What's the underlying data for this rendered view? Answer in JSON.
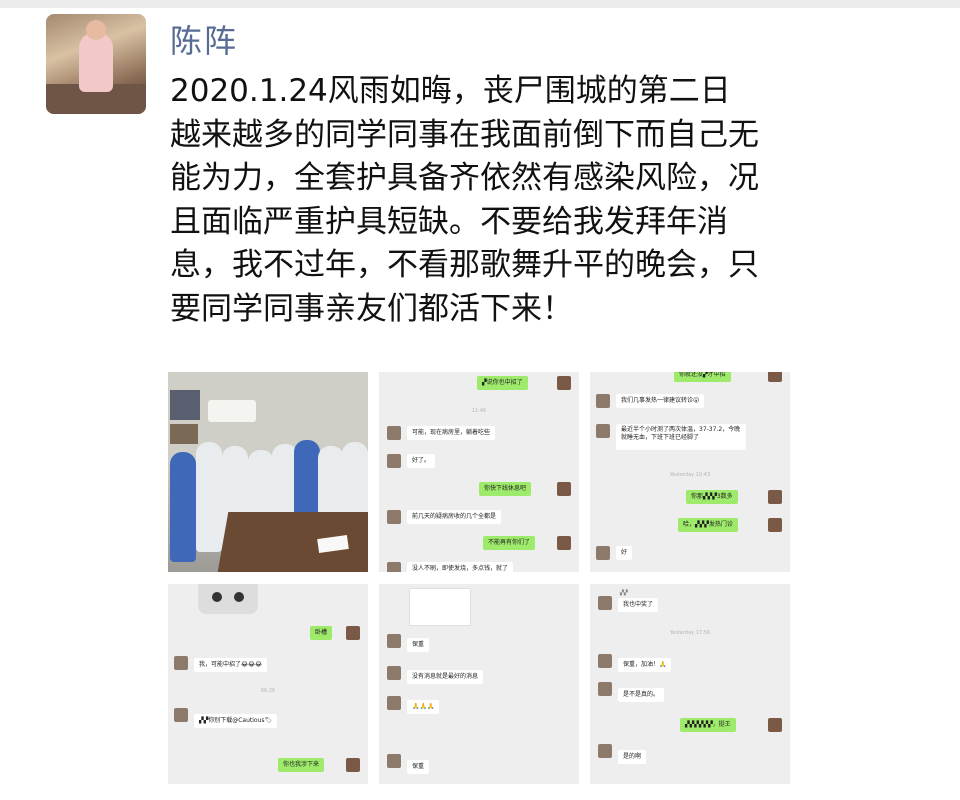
{
  "post": {
    "author": "陈阵",
    "lines": [
      "2020.1.24风雨如晦，丧尸围城的第二日",
      "越来越多的同学同事在我面前倒下而自己无",
      "能为力，全套护具备齐依然有感染风险，况",
      "且面临严重护具短缺。不要给我发拜年消",
      "息，我不过年，不看那歌舞升平的晚会，只",
      "要同学同事亲友们都活下来！"
    ]
  },
  "screenshots": {
    "s2": {
      "m1": "▞说你也中招了",
      "m2": "可能，现在病房里，躺着吃些",
      "m3": "好了。",
      "m4": "你快下线休息吧",
      "m5": "前几天的疑病房收的几个全都是",
      "m6": "不能再有你们了",
      "m7": "没人不刷，即使发烧，多点钱，就了",
      "ts1": "11:46"
    },
    "s3": {
      "m0": "你就还没▞才中招",
      "m1": "我们几事发热一律建议转诊😮",
      "m2": "最近半个小时测了两次体温，37-37.2，今晚就睡无血，下班下班已经脚了",
      "ts1": "Yesterday 10:43",
      "m3": "你那▞▞▞3数多",
      "m4": "哈，▞▞▞发热门诊",
      "m5": "好"
    },
    "s4": {
      "m1": "卧槽",
      "m2": "我，可能中招了😂😂😂",
      "ts1": "06:26",
      "m3": "▞▞你别下载@Cautious🏷",
      "m4": "你也我涉下来"
    },
    "s5": {
      "m1": "保重",
      "m2": "没有消息就是最好的消息",
      "m3": "🙏🙏🙏",
      "m4": "保重"
    },
    "s6": {
      "nick1": "▞▞",
      "m1": "我也中奖了",
      "ts1": "Yesterday 17:56",
      "m2": "保重，加油！🙏",
      "m3": "是不是真的。",
      "m4": "▞▞▞▞▞▞，挺王",
      "m5": "是的啊"
    }
  }
}
